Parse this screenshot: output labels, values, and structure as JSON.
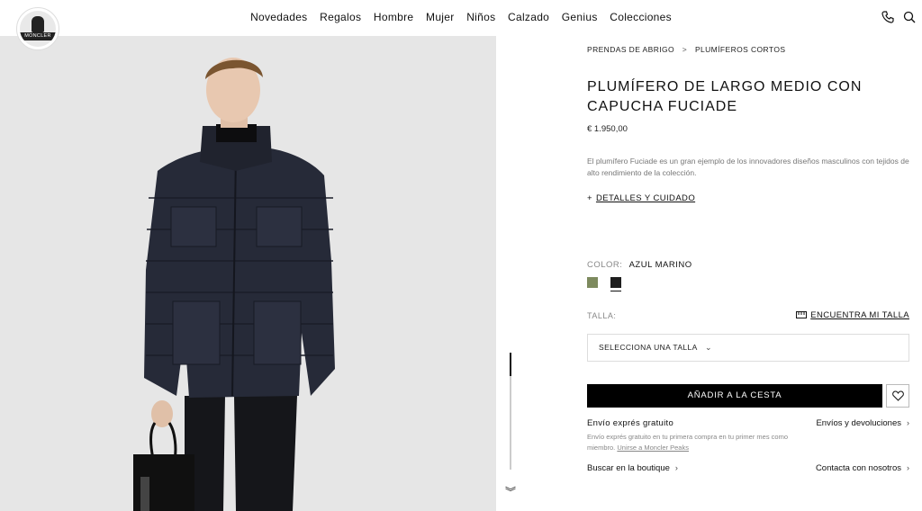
{
  "brand": {
    "logo_text": "MONCLER"
  },
  "nav": {
    "items": [
      "Novedades",
      "Regalos",
      "Hombre",
      "Mujer",
      "Niños",
      "Calzado",
      "Genius",
      "Colecciones"
    ],
    "icons": [
      "phone-icon",
      "search-icon"
    ]
  },
  "breadcrumb": {
    "level1": "PRENDAS DE ABRIGO",
    "separator": ">",
    "level2": "PLUMÍFEROS CORTOS"
  },
  "product": {
    "title": "PLUMÍFERO DE LARGO MEDIO CON CAPUCHA FUCIADE",
    "price": "€ 1.950,00",
    "description": "El plumífero Fuciade es un gran ejemplo de los innovadores diseños masculinos con tejidos de alto rendimiento de la colección.",
    "details_label": "DETALLES Y CUIDADO",
    "details_prefix": "+"
  },
  "color": {
    "label": "COLOR:",
    "selected": "AZUL MARINO",
    "swatches": [
      {
        "name": "olive",
        "hex": "#7d8a5e"
      },
      {
        "name": "black",
        "hex": "#1e1e1e"
      }
    ]
  },
  "size": {
    "label": "TALLA:",
    "find_label": "ENCUENTRA MI TALLA",
    "select_placeholder": "SELECCIONA UNA TALLA"
  },
  "actions": {
    "add_to_cart": "AÑADIR A LA CESTA"
  },
  "shipping": {
    "title": "Envío exprés gratuito",
    "text": "Envío exprés gratuito en tu primera compra en tu primer mes como miembro.",
    "link": "Unirse a Moncler Peaks",
    "returns": "Envíos y devoluciones"
  },
  "links": {
    "boutique": "Buscar en la boutique",
    "contact": "Contacta con nosotros"
  },
  "colors": {
    "background": "#ffffff",
    "hero_bg": "#e6e6e6",
    "button": "#000000",
    "jacket": "#262a38"
  }
}
